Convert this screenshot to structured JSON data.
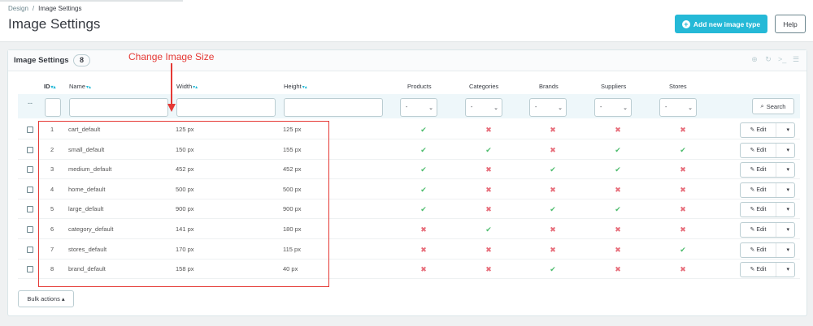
{
  "breadcrumb": {
    "parent": "Design",
    "separator": "/",
    "current": "Image Settings"
  },
  "page_title": "Image Settings",
  "toolbar": {
    "add_label": "Add new image type",
    "help_label": "Help"
  },
  "panel": {
    "title": "Image Settings",
    "count": "8"
  },
  "annotation": {
    "text": "Change Image Size",
    "color": "#e53935"
  },
  "columns": {
    "id": "ID",
    "name": "Name",
    "width": "Width",
    "height": "Height",
    "products": "Products",
    "categories": "Categories",
    "brands": "Brands",
    "suppliers": "Suppliers",
    "stores": "Stores"
  },
  "filters": {
    "dash": "--",
    "select_value": "-",
    "search_label": "Search"
  },
  "rows": [
    {
      "id": "1",
      "name": "cart_default",
      "width": "125 px",
      "height": "125 px",
      "flags": [
        true,
        false,
        false,
        false,
        false
      ]
    },
    {
      "id": "2",
      "name": "small_default",
      "width": "150 px",
      "height": "155 px",
      "flags": [
        true,
        true,
        false,
        true,
        true
      ]
    },
    {
      "id": "3",
      "name": "medium_default",
      "width": "452 px",
      "height": "452 px",
      "flags": [
        true,
        false,
        true,
        true,
        false
      ]
    },
    {
      "id": "4",
      "name": "home_default",
      "width": "500 px",
      "height": "500 px",
      "flags": [
        true,
        false,
        false,
        false,
        false
      ]
    },
    {
      "id": "5",
      "name": "large_default",
      "width": "900 px",
      "height": "900 px",
      "flags": [
        true,
        false,
        true,
        true,
        false
      ]
    },
    {
      "id": "6",
      "name": "category_default",
      "width": "141 px",
      "height": "180 px",
      "flags": [
        false,
        true,
        false,
        false,
        false
      ]
    },
    {
      "id": "7",
      "name": "stores_default",
      "width": "170 px",
      "height": "115 px",
      "flags": [
        false,
        false,
        false,
        false,
        true
      ]
    },
    {
      "id": "8",
      "name": "brand_default",
      "width": "158 px",
      "height": "40 px",
      "flags": [
        false,
        false,
        true,
        false,
        false
      ]
    }
  ],
  "row_action": {
    "edit_label": "Edit"
  },
  "bulk_label": "Bulk actions",
  "colors": {
    "accent": "#25b9d7",
    "yes": "#4cbb6c",
    "no": "#e76d7a"
  }
}
